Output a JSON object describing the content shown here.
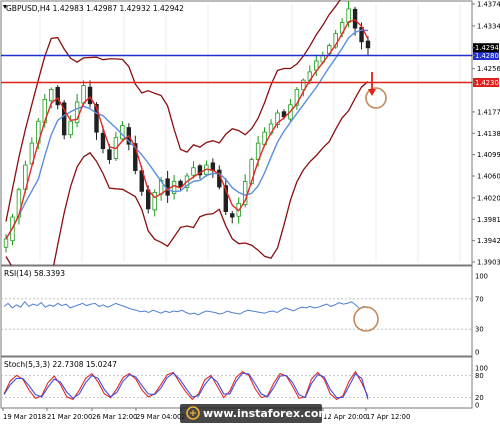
{
  "chart_data": [
    {
      "type": "candlestick",
      "symbol_line": "GBPUSD,H4  1.42983 1.42987 1.42932 1.42942",
      "price_ticks": [
        "1.43740",
        "1.43340",
        "1.42942",
        "1.42800",
        "1.42560",
        "1.42307",
        "1.41770",
        "1.41380",
        "1.40990",
        "1.40600",
        "1.40200",
        "1.39810",
        "1.39420",
        "1.39030"
      ],
      "ylim": [
        1.3903,
        1.4374
      ],
      "x_labels": [
        "19 Mar 2018",
        "21 Mar 20:00",
        "26 Mar 12:00",
        "29 Mar 04:00",
        "2",
        "12 Apr 20:00",
        "17 Apr 12:00"
      ],
      "levels": [
        {
          "name": "resistance",
          "value": 1.428,
          "label": "1.42800",
          "color": "#1f2fd0"
        },
        {
          "name": "support",
          "value": 1.42307,
          "label": "1.42307",
          "color": "#e0201b"
        }
      ],
      "current_price": {
        "value": 1.42942,
        "label": "1.42942"
      },
      "close_path": [
        1.3945,
        1.3985,
        1.4035,
        1.408,
        1.412,
        1.416,
        1.42,
        1.4218,
        1.419,
        1.4135,
        1.416,
        1.4195,
        1.4225,
        1.4192,
        1.414,
        1.411,
        1.409,
        1.413,
        1.4152,
        1.4118,
        1.407,
        1.4032,
        1.4,
        1.403,
        1.4052,
        1.4025,
        1.405,
        1.404,
        1.406,
        1.4075,
        1.4062,
        1.408,
        1.407,
        1.404,
        1.3995,
        1.3985,
        1.401,
        1.405,
        1.409,
        1.412,
        1.414,
        1.4155,
        1.4175,
        1.4168,
        1.419,
        1.4218,
        1.4235,
        1.425,
        1.427,
        1.428,
        1.4298,
        1.432,
        1.434,
        1.4365,
        1.433,
        1.4305,
        1.4294
      ],
      "colors": {
        "bull": "#1a9a1a",
        "bear": "#202020",
        "bollinger": "#8b0f0f",
        "ma_fast": "#e32828",
        "ma_slow": "#5b8ee0"
      }
    },
    {
      "type": "line",
      "label": "RSI(14) 58.3393",
      "y_ticks": [
        "100",
        "70",
        "30",
        "0"
      ],
      "ylim": [
        0,
        100
      ],
      "values": [
        60,
        64,
        58,
        62,
        59,
        66,
        60,
        63,
        61,
        65,
        59,
        62,
        60,
        64,
        61,
        63,
        58,
        60,
        62,
        64,
        61,
        63,
        64,
        60,
        62,
        59,
        61,
        64,
        62,
        60,
        58,
        56,
        55,
        53,
        54,
        52,
        55,
        53,
        51,
        54,
        52,
        54,
        53,
        55,
        52,
        50,
        51,
        49,
        52,
        54,
        53,
        52,
        50,
        51,
        54,
        52,
        51,
        50,
        53,
        55,
        54,
        53,
        52,
        51,
        53,
        54,
        52,
        55,
        58,
        56,
        54,
        57,
        59,
        58,
        60,
        58,
        59,
        61,
        63,
        60,
        62,
        65,
        63,
        64,
        66,
        62,
        57,
        60,
        58
      ],
      "color": "#4f7fd8"
    },
    {
      "type": "line",
      "label": "Stoch(5,3,3) 22.7308 15.0247",
      "y_ticks": [
        "100",
        "80",
        "20",
        "0"
      ],
      "ylim": [
        0,
        100
      ],
      "series": [
        {
          "values": [
            30,
            65,
            80,
            70,
            40,
            18,
            25,
            60,
            78,
            55,
            22,
            15,
            40,
            72,
            85,
            62,
            30,
            20,
            45,
            75,
            85,
            70,
            40,
            22,
            30,
            55,
            82,
            88,
            60,
            35,
            15,
            30,
            68,
            80,
            50,
            20,
            38,
            75,
            90,
            80,
            45,
            20,
            25,
            60,
            85,
            78,
            50,
            18,
            22,
            70,
            88,
            70,
            30,
            15,
            25,
            65,
            90,
            60,
            23
          ],
          "color": "#e32828"
        },
        {
          "values": [
            28,
            55,
            72,
            72,
            52,
            28,
            22,
            48,
            70,
            62,
            35,
            18,
            30,
            60,
            80,
            72,
            42,
            22,
            35,
            65,
            82,
            76,
            52,
            30,
            28,
            46,
            74,
            86,
            70,
            45,
            22,
            25,
            55,
            76,
            62,
            30,
            30,
            64,
            86,
            84,
            58,
            30,
            22,
            48,
            78,
            80,
            60,
            28,
            20,
            58,
            82,
            76,
            42,
            20,
            20,
            52,
            84,
            72,
            15
          ],
          "color": "#3b4fe0"
        }
      ]
    }
  ],
  "watermark": "www.instaforex.com"
}
